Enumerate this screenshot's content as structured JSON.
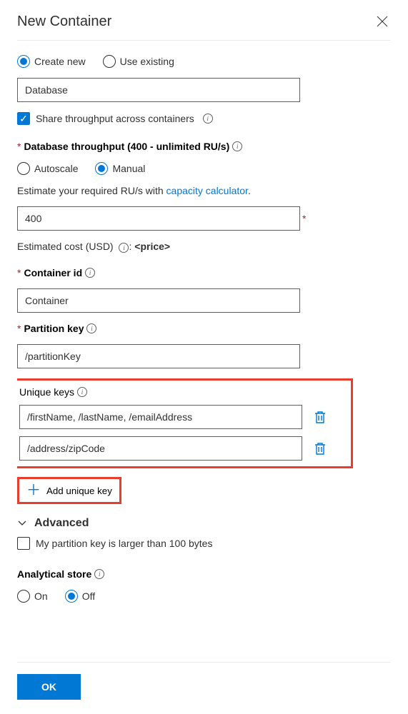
{
  "header": {
    "title": "New Container"
  },
  "databaseMode": {
    "createNew": "Create new",
    "useExisting": "Use existing",
    "selected": "createNew"
  },
  "databaseName": {
    "value": "Database"
  },
  "shareThroughput": {
    "label": "Share throughput across containers",
    "checked": true
  },
  "throughput": {
    "heading": "Database throughput (400 - unlimited RU/s)",
    "autoscale": "Autoscale",
    "manual": "Manual",
    "selected": "manual",
    "estimateTextPrefix": "Estimate your required RU/s with ",
    "calculatorLink": "capacity calculator",
    "estimateTextSuffix": ".",
    "value": "400",
    "estimatedCostLabel": "Estimated cost (USD) ",
    "estimatedCostValue": "<price>"
  },
  "containerId": {
    "label": "Container id",
    "value": "Container"
  },
  "partitionKey": {
    "label": "Partition key",
    "value": "/partitionKey"
  },
  "uniqueKeys": {
    "label": "Unique keys",
    "items": [
      "/firstName, /lastName, /emailAddress",
      "/address/zipCode"
    ],
    "addButton": "Add unique key"
  },
  "advanced": {
    "label": "Advanced",
    "partitionLargerLabel": "My partition key is larger than 100 bytes",
    "partitionLargerChecked": false
  },
  "analyticalStore": {
    "label": "Analytical store",
    "on": "On",
    "off": "Off",
    "selected": "off"
  },
  "footer": {
    "ok": "OK"
  }
}
